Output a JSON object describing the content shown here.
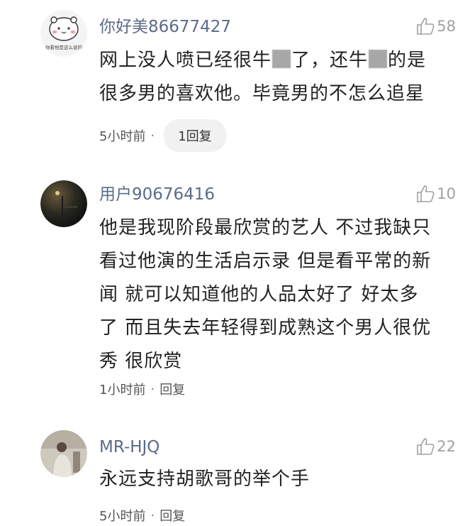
{
  "comments": [
    {
      "username": "你好美86677427",
      "avatar_caption": "你看他是这么说的",
      "likes": "58",
      "lines": [
        {
          "before": "网上没人喷已经很牛",
          "after": "了，还牛",
          "tail": "的是"
        },
        {
          "text": "很多男的喜欢他。毕竟男的不怎么追星"
        }
      ],
      "time": "5小时前",
      "dot": "·",
      "reply": "1回复"
    },
    {
      "username": "用户90676416",
      "likes": "10",
      "lines": [
        "他是我现阶段最欣赏的艺人  不过我缺只",
        "看过他演的生活启示录  但是看平常的新",
        "闻  就可以知道他的人品太好了  好太多",
        "了  而且失去年轻得到成熟这个男人很优",
        "秀  很欣赏"
      ],
      "time": "1小时前",
      "dot": "·",
      "reply": "回复"
    },
    {
      "username": "MR-HJQ",
      "likes": "22",
      "lines": [
        "永远支持胡歌哥的举个手"
      ],
      "time": "5小时前",
      "dot": "·",
      "reply": "回复"
    }
  ],
  "colors": {
    "username": "#5b6b8a",
    "body_text": "#222222",
    "meta_text": "#555555",
    "like_icon": "#a0a0a0",
    "reply_pill_bg": "#f1f1f1"
  },
  "icons": {
    "like": "thumbs-up-icon"
  }
}
